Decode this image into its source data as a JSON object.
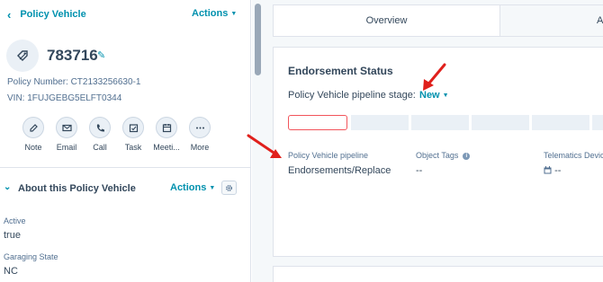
{
  "sidebar": {
    "back_title": "Policy Vehicle",
    "actions_label": "Actions",
    "record_id": "783716",
    "policy_number": "Policy Number: CT2133256630-1",
    "vin": "VIN: 1FUJGEBG5ELFT0344",
    "activity_buttons": [
      {
        "label": "Note",
        "icon": "note-icon"
      },
      {
        "label": "Email",
        "icon": "email-icon"
      },
      {
        "label": "Call",
        "icon": "phone-icon"
      },
      {
        "label": "Task",
        "icon": "task-icon"
      },
      {
        "label": "Meeti...",
        "icon": "calendar-icon"
      },
      {
        "label": "More",
        "icon": "more-icon"
      }
    ],
    "about": {
      "title": "About this Policy Vehicle",
      "actions_label": "Actions",
      "properties": [
        {
          "label": "Active",
          "value": "true"
        },
        {
          "label": "Garaging State",
          "value": "NC"
        }
      ]
    }
  },
  "main": {
    "tabs": [
      {
        "label": "Overview"
      },
      {
        "label": "A"
      }
    ],
    "card": {
      "title": "Endorsement Status",
      "stage_label": "Policy Vehicle pipeline stage:",
      "stage_value": "New",
      "fields": [
        {
          "label": "Policy Vehicle pipeline",
          "value": "Endorsements/Replace"
        },
        {
          "label": "Object Tags",
          "value": "--"
        },
        {
          "label": "Telematics Devic",
          "value": "--"
        }
      ]
    }
  },
  "colors": {
    "accent": "#0091ae",
    "text": "#33475b",
    "muted": "#516f90",
    "annotation_arrow": "#e0201c",
    "active_stage_border": "#f2545b"
  }
}
